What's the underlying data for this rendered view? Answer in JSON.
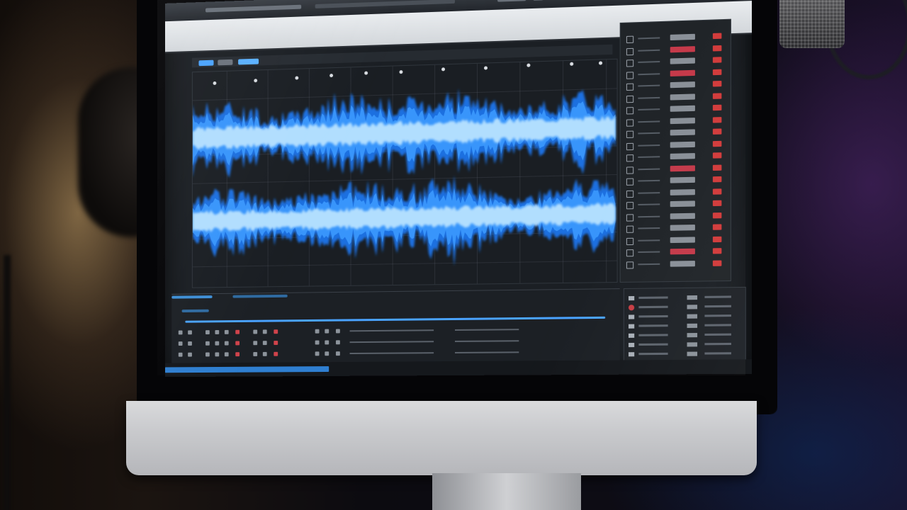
{
  "scene": {
    "subject": "",
    "colors": {
      "waveform_outer": "#1e6fe0",
      "waveform_mid": "#3d9bff",
      "waveform_core": "#bfe6ff",
      "accent_red": "#d23b3b",
      "monitor_silver": "#c9cacd"
    }
  },
  "daw": {
    "topbar": {
      "counter_left": "",
      "counter_right": ""
    },
    "side_panel": {
      "row_count": 20
    },
    "mixer": {
      "row_count": 7
    },
    "transport": {
      "track_rows": 3
    }
  }
}
